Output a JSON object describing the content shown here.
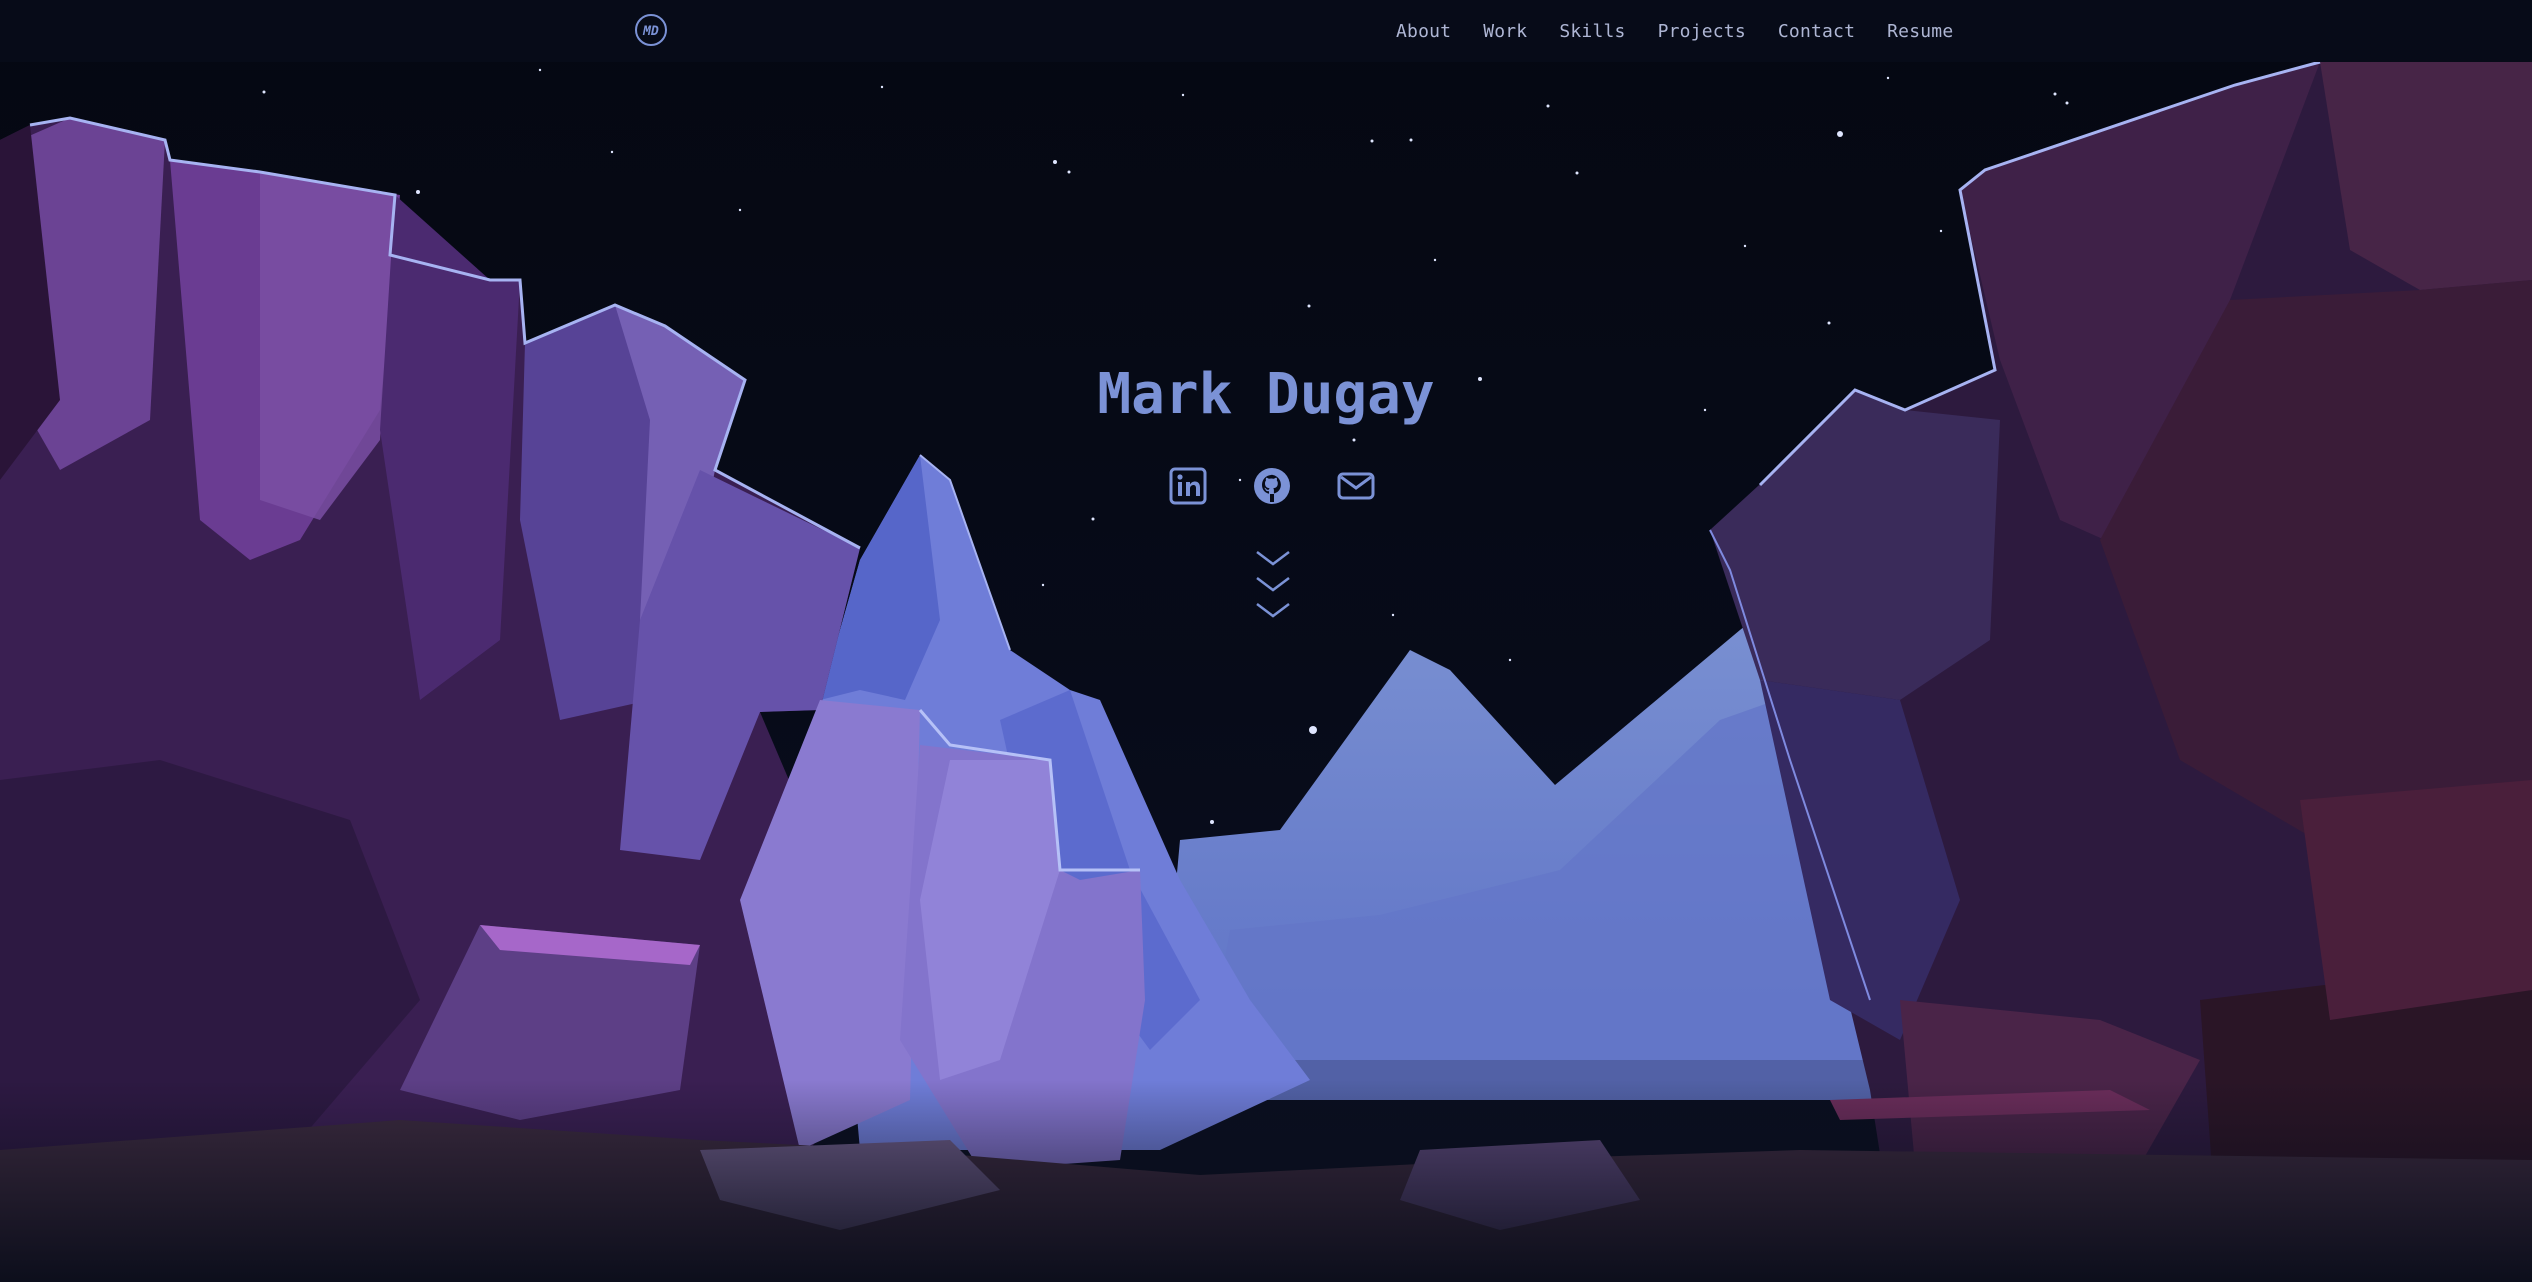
{
  "brand": {
    "logo_text": "MD",
    "logo_icon": "md-monogram-logo"
  },
  "nav": {
    "items": [
      {
        "label": "About"
      },
      {
        "label": "Work"
      },
      {
        "label": "Skills"
      },
      {
        "label": "Projects"
      },
      {
        "label": "Contact"
      },
      {
        "label": "Resume"
      }
    ]
  },
  "hero": {
    "name": "Mark Dugay",
    "social": [
      {
        "icon": "linkedin-icon"
      },
      {
        "icon": "github-icon"
      },
      {
        "icon": "email-icon"
      }
    ],
    "scroll_icon": "triple-chevron-down-icon"
  },
  "colors": {
    "background": "#060914",
    "accent": "#7b92d6",
    "nav_text": "#aeb6d4",
    "sky_glow": "#7a92d2"
  }
}
